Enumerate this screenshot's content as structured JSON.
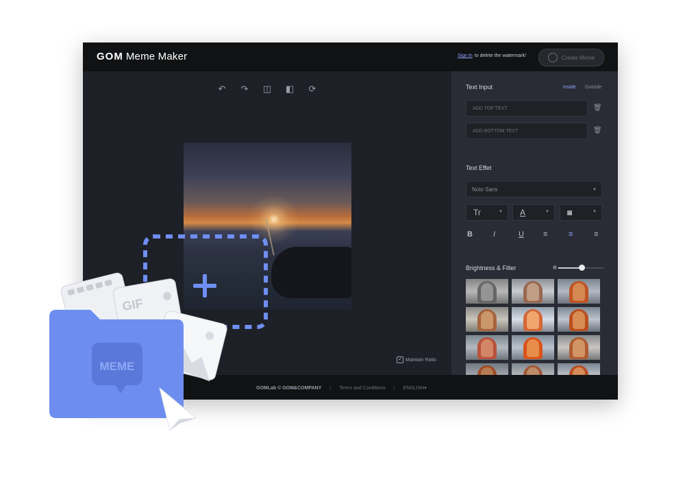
{
  "header": {
    "logo_brand": "GOM",
    "logo_name": "Meme Maker",
    "signin_link": "Sign In",
    "signin_text": "to delete the watermark!",
    "create_button": "Create Meme"
  },
  "canvas": {
    "maintain_ratio": "Maintain Ratio",
    "maintain_ratio_checked": true
  },
  "panel": {
    "text_input_title": "Text Input",
    "inside_tab": "Inside",
    "outside_tab": "Outside",
    "top_text_placeholder": "ADD TOP TEXT",
    "bottom_text_placeholder": "ADD BOTTOM TEXT",
    "text_effect_title": "Text Effet",
    "font_value": "Noto Sans",
    "brightness_title": "Brightness & Filter"
  },
  "footer": {
    "copyright": "GOMLab © GOM&COMPANY",
    "terms": "Terms and Conditions",
    "language": "ENGLISH"
  },
  "illustration": {
    "gif_label": "GIF",
    "meme_label": "MEME"
  },
  "colors": {
    "accent": "#8fa4ff",
    "folder_blue": "#6d8ef0",
    "dash_blue": "#6f8ff3"
  }
}
